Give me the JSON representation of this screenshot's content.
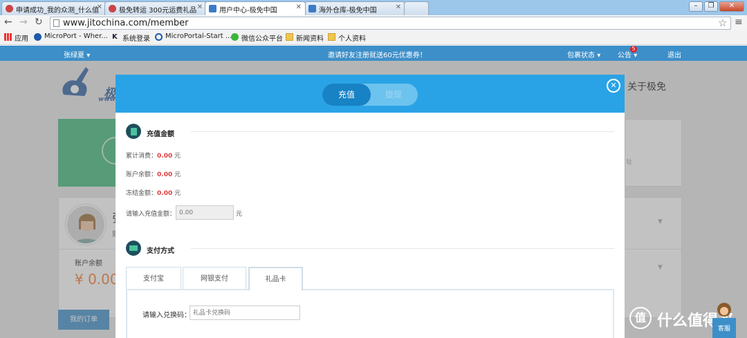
{
  "browser": {
    "tabs": [
      {
        "title": "申请成功_我的众测_什么值"
      },
      {
        "title": "极免转运 300元运费礼品"
      },
      {
        "title": "用户中心-极免中国"
      },
      {
        "title": "海外仓库-极免中国"
      }
    ],
    "url": "www.jitochina.com/member",
    "bookmarks": [
      "应用",
      "MicroPort - Wher...",
      "系统登录",
      "MicroPortal-Start ...",
      "微信公众平台",
      "新闻资料",
      "个人资料"
    ]
  },
  "site": {
    "user": "张绿夏",
    "promo": "邀请好友注册就送60元优惠券！",
    "package_status": "包裹状态",
    "notice": "公告",
    "notice_count": "5",
    "logout": "退出",
    "about": "关于极免",
    "logo_text": "极",
    "logo_sub": "www",
    "address_hint": "址",
    "initial": "张",
    "sub_initial": "则",
    "balance_label": "账户余额",
    "balance_value": "¥ 0.00",
    "orders_tab": "我的订单"
  },
  "modal": {
    "tab_recharge": "充值",
    "tab_withdraw": "提现",
    "section_amount": "充值金额",
    "rows": [
      {
        "label": "累计消费：",
        "value": "0.00",
        "unit": "元"
      },
      {
        "label": "账户余额：",
        "value": "0.00",
        "unit": "元"
      },
      {
        "label": "冻结金额：",
        "value": "0.00",
        "unit": "元"
      }
    ],
    "input_label": "请输入充值金额：",
    "input_placeholder": "0.00",
    "input_unit": "元",
    "section_payment": "支付方式",
    "pay_tabs": [
      "支付宝",
      "网银支付",
      "礼品卡"
    ],
    "redeem_label": "请输入兑换码：",
    "redeem_placeholder": "礼品卡兑换码"
  },
  "watermark": {
    "text": "什么值得买"
  },
  "helper": {
    "text": "客服"
  },
  "colors": {
    "primary": "#2aa3e6",
    "sitebar": "#3d8fc9",
    "amount": "#e03c3c",
    "green": "#3cb878"
  }
}
